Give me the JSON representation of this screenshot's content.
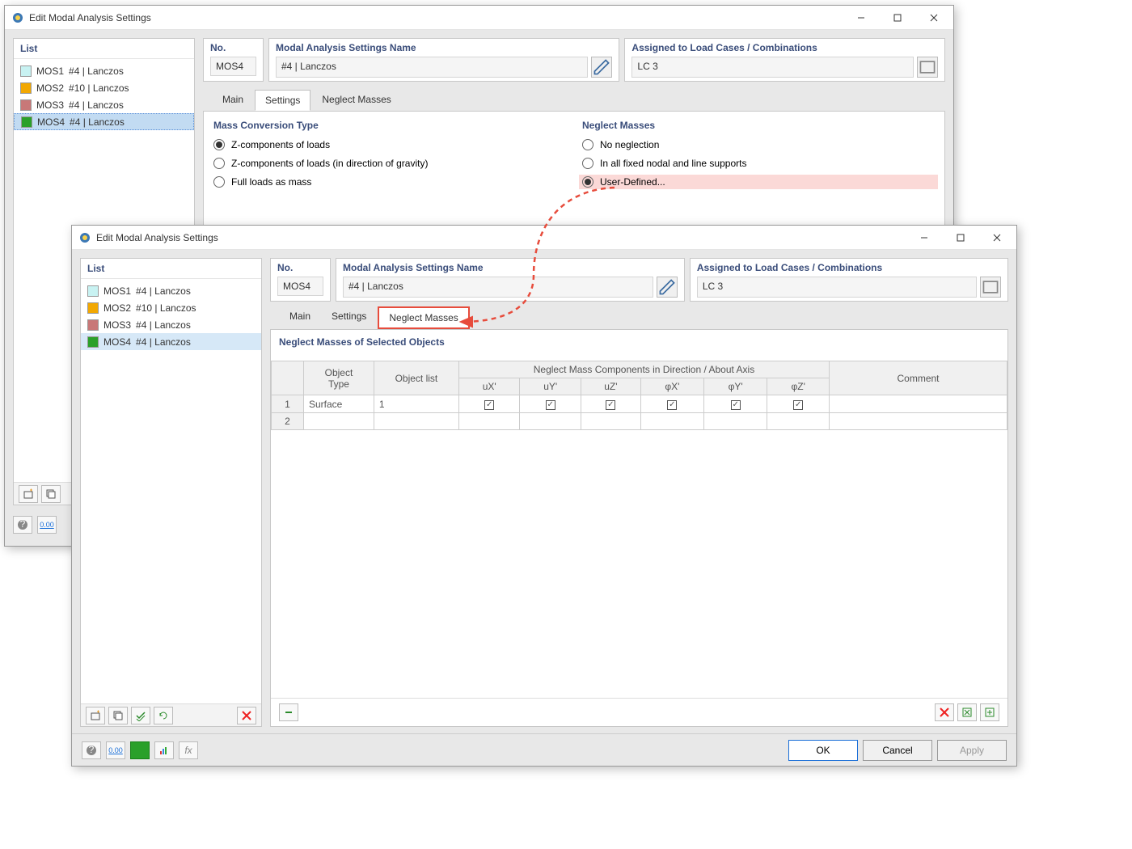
{
  "window1": {
    "title": "Edit Modal Analysis Settings",
    "left": {
      "header": "List",
      "items": [
        {
          "swatch": "#c8f2f2",
          "code": "MOS1",
          "label": "#4 | Lanczos"
        },
        {
          "swatch": "#f2a802",
          "code": "MOS2",
          "label": "#10 | Lanczos"
        },
        {
          "swatch": "#c87878",
          "code": "MOS3",
          "label": "#4 | Lanczos"
        },
        {
          "swatch": "#2aa02a",
          "code": "MOS4",
          "label": "#4 | Lanczos"
        }
      ]
    },
    "fields": {
      "no_label": "No.",
      "no_value": "MOS4",
      "name_label": "Modal Analysis Settings Name",
      "name_value": "#4 | Lanczos",
      "assigned_label": "Assigned to Load Cases / Combinations",
      "assigned_value": "LC 3"
    },
    "tabs": {
      "main": "Main",
      "settings": "Settings",
      "neglect": "Neglect Masses"
    },
    "mass_conv": {
      "title": "Mass Conversion Type",
      "opts": [
        "Z-components of loads",
        "Z-components of loads (in direction of gravity)",
        "Full loads as mass"
      ],
      "sel": 0
    },
    "neglect": {
      "title": "Neglect Masses",
      "opts": [
        "No neglection",
        "In all fixed nodal and line supports",
        "User-Defined..."
      ],
      "sel": 2
    }
  },
  "window2": {
    "title": "Edit Modal Analysis Settings",
    "left": {
      "header": "List",
      "items": [
        {
          "swatch": "#c8f2f2",
          "code": "MOS1",
          "label": "#4 | Lanczos"
        },
        {
          "swatch": "#f2a802",
          "code": "MOS2",
          "label": "#10 | Lanczos"
        },
        {
          "swatch": "#c87878",
          "code": "MOS3",
          "label": "#4 | Lanczos"
        },
        {
          "swatch": "#2aa02a",
          "code": "MOS4",
          "label": "#4 | Lanczos"
        }
      ]
    },
    "fields": {
      "no_label": "No.",
      "no_value": "MOS4",
      "name_label": "Modal Analysis Settings Name",
      "name_value": "#4 | Lanczos",
      "assigned_label": "Assigned to Load Cases / Combinations",
      "assigned_value": "LC 3"
    },
    "tabs": {
      "main": "Main",
      "settings": "Settings",
      "neglect": "Neglect Masses"
    },
    "table": {
      "title": "Neglect Masses of Selected Objects",
      "headers": {
        "obj_type": "Object\nType",
        "obj_list": "Object list",
        "group": "Neglect Mass Components in Direction / About Axis",
        "comment": "Comment",
        "cols": [
          "uX'",
          "uY'",
          "uZ'",
          "φX'",
          "φY'",
          "φZ'"
        ]
      },
      "rows": [
        {
          "n": "1",
          "type": "Surface",
          "list": "1",
          "chk": [
            true,
            true,
            true,
            true,
            true,
            true
          ],
          "comment": ""
        },
        {
          "n": "2",
          "type": "",
          "list": "",
          "chk": [
            null,
            null,
            null,
            null,
            null,
            null
          ],
          "comment": ""
        }
      ]
    },
    "buttons": {
      "ok": "OK",
      "cancel": "Cancel",
      "apply": "Apply"
    }
  },
  "ext_btn": "0.00"
}
